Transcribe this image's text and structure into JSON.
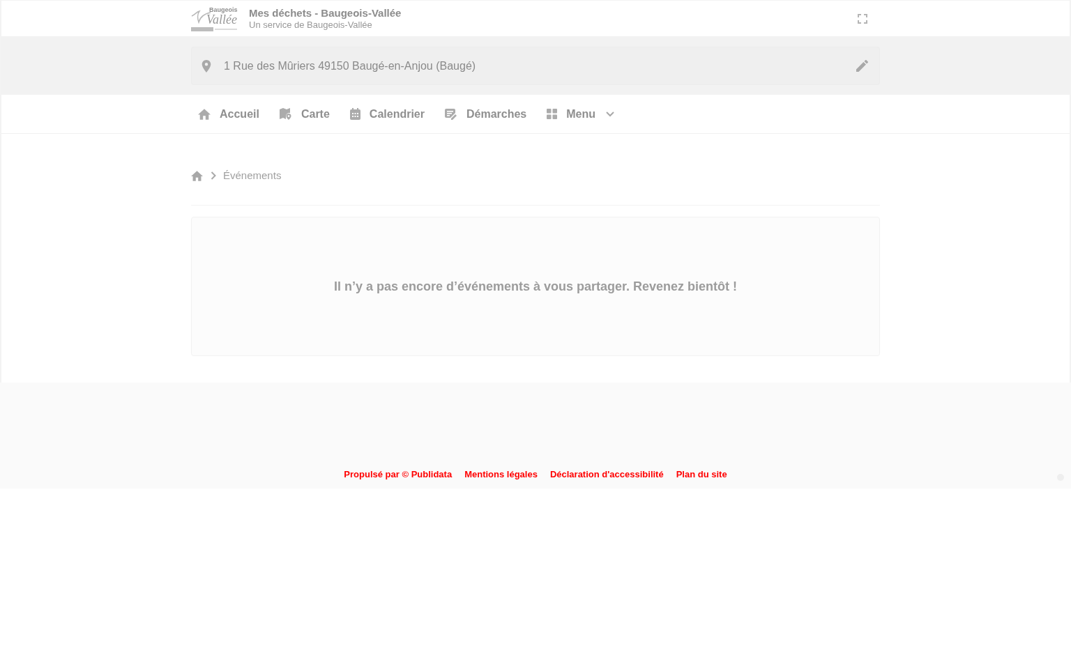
{
  "header": {
    "logo": {
      "line_1": "Baugeois",
      "line_2": "Vallée"
    },
    "title": "Mes déchets - Baugeois-Vallée",
    "subtitle": "Un service de Baugeois-Vallée"
  },
  "address": {
    "value": "1 Rue des Mûriers 49150 Baugé-en-Anjou (Baugé)"
  },
  "nav": [
    {
      "label": "Accueil",
      "kind": "home",
      "dropdown": false
    },
    {
      "label": "Carte",
      "kind": "map",
      "dropdown": false
    },
    {
      "label": "Calendrier",
      "kind": "calendar",
      "dropdown": false
    },
    {
      "label": "Démarches",
      "kind": "form",
      "dropdown": false
    },
    {
      "label": "Menu",
      "kind": "grid",
      "dropdown": true
    }
  ],
  "breadcrumb": {
    "current": "Événements"
  },
  "empty_message": "Il n’y a pas encore d’événements à vous partager. Revenez bientôt !",
  "footer": {
    "links": [
      "Propulsé par © Publidata",
      "Mentions légales",
      "Déclaration d'accessibilité",
      "Plan du site"
    ]
  }
}
